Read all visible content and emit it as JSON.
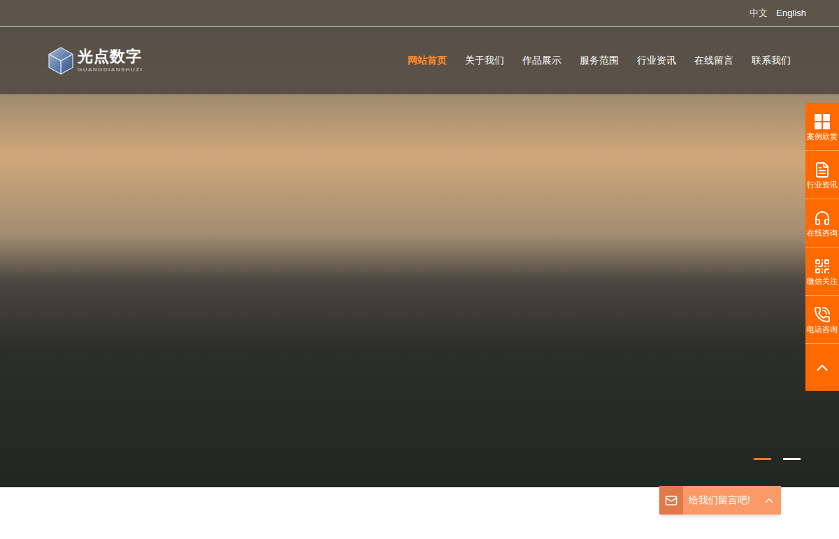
{
  "language": [
    {
      "label": "中文",
      "selected": false
    },
    {
      "label": "English",
      "selected": true
    }
  ],
  "logo": {
    "name": "光点数字",
    "subtitle": "GUANGDIANSHUZI"
  },
  "nav": [
    {
      "label": "网站首页",
      "selected": true
    },
    {
      "label": "关于我们",
      "selected": false
    },
    {
      "label": "作品展示",
      "selected": false
    },
    {
      "label": "服务范围",
      "selected": false
    },
    {
      "label": "行业资讯",
      "selected": false
    },
    {
      "label": "在线留言",
      "selected": false
    },
    {
      "label": "联系我们",
      "selected": false
    }
  ],
  "hero": {
    "slides": [
      {
        "selected": true
      },
      {
        "selected": false
      }
    ]
  },
  "side_toolbar": [
    {
      "label": "案例欣赏",
      "kind": "grid"
    },
    {
      "label": "行业资讯",
      "kind": "news"
    },
    {
      "label": "在线咨询",
      "kind": "chat"
    },
    {
      "label": "微信关注",
      "kind": "qr"
    },
    {
      "label": "电话咨询",
      "kind": "phone"
    }
  ],
  "message_bar": {
    "label": "给我们留言吧!",
    "expanded": false
  }
}
